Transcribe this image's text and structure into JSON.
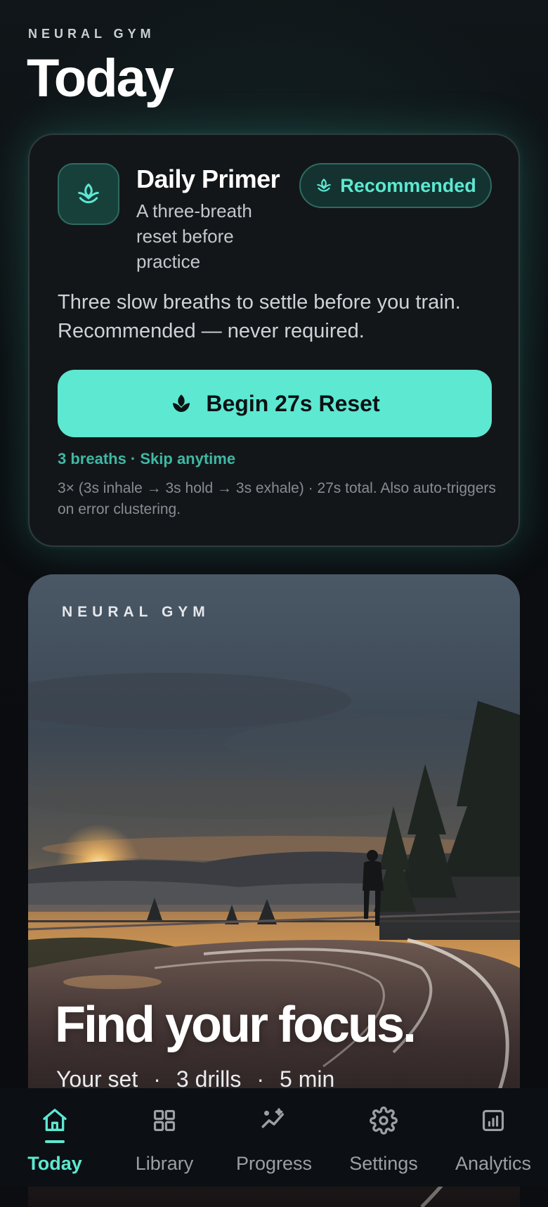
{
  "header": {
    "eyebrow": "NEURAL GYM",
    "title": "Today"
  },
  "primer": {
    "icon": "lotus-icon",
    "title": "Daily Primer",
    "subtitle": "A three-breath reset before practice",
    "badge_label": "Recommended",
    "badge_icon": "lotus-icon",
    "body": "Three slow breaths to settle before you train. Recommended — never required.",
    "button_label": "Begin 27s Reset",
    "button_icon": "leaf-icon",
    "meta": "3 breaths · Skip anytime",
    "footnote": "3× (3s inhale → 3s hold → 3s exhale) · 27s total. Also auto-triggers on error clustering."
  },
  "hero": {
    "eyebrow": "NEURAL GYM",
    "title": "Find your focus.",
    "meta": [
      "Your set",
      "3 drills",
      "5 min"
    ],
    "meta_separator": "·"
  },
  "nav": {
    "items": [
      {
        "label": "Today",
        "icon": "home-icon",
        "active": true
      },
      {
        "label": "Library",
        "icon": "grid-icon",
        "active": false
      },
      {
        "label": "Progress",
        "icon": "sparkline-icon",
        "active": false
      },
      {
        "label": "Settings",
        "icon": "gear-icon",
        "active": false
      },
      {
        "label": "Analytics",
        "icon": "bar-chart-icon",
        "active": false
      }
    ]
  },
  "colors": {
    "accent": "#5de8d2",
    "background": "#0b0d10",
    "card": "#131619"
  }
}
